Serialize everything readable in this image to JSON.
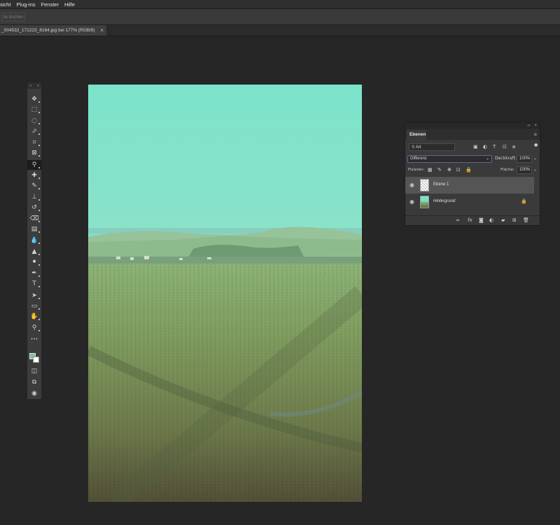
{
  "menu": [
    "sicht",
    "Plug-ins",
    "Fenster",
    "Hilfe"
  ],
  "options": {
    "button_label": "lle löschen"
  },
  "document": {
    "tab_title": "_004532_171223_8164.jpg bei 177% (RGB/8)",
    "close": "×"
  },
  "toolbox": {
    "head_left": "‹‹",
    "head_right": "×",
    "tools": [
      {
        "name": "move-tool",
        "glyph": "✥"
      },
      {
        "name": "marquee-tool",
        "glyph": "⬚"
      },
      {
        "name": "lasso-tool",
        "glyph": "◌"
      },
      {
        "name": "quick-select-tool",
        "glyph": "⬀"
      },
      {
        "name": "crop-tool",
        "glyph": "⌗"
      },
      {
        "name": "frame-tool",
        "glyph": "⊠"
      },
      {
        "name": "eyedropper-tool",
        "glyph": "⚲"
      },
      {
        "name": "healing-brush-tool",
        "glyph": "✚"
      },
      {
        "name": "brush-tool",
        "glyph": "✎"
      },
      {
        "name": "clone-stamp-tool",
        "glyph": "⊥"
      },
      {
        "name": "history-brush-tool",
        "glyph": "↺"
      },
      {
        "name": "eraser-tool",
        "glyph": "⌫"
      },
      {
        "name": "gradient-tool",
        "glyph": "▤"
      },
      {
        "name": "blur-tool",
        "glyph": "💧"
      },
      {
        "name": "sharpen-tool",
        "glyph": "▲"
      },
      {
        "name": "dodge-tool",
        "glyph": "⚫"
      },
      {
        "name": "pen-tool",
        "glyph": "✒"
      },
      {
        "name": "type-tool",
        "glyph": "T"
      },
      {
        "name": "path-select-tool",
        "glyph": "➤"
      },
      {
        "name": "rectangle-tool",
        "glyph": "▭"
      },
      {
        "name": "hand-tool",
        "glyph": "✋"
      },
      {
        "name": "zoom-tool",
        "glyph": "⚲"
      },
      {
        "name": "more-tools",
        "glyph": "•••"
      }
    ]
  },
  "layers_panel": {
    "top_icons": [
      "‹‹",
      "×"
    ],
    "tab": "Ebenen",
    "filter_value": "Art",
    "blend_mode": "Differenz",
    "opacity_label": "Deckkraft:",
    "opacity_value": "100%",
    "lock_label": "Fixieren:",
    "fill_label": "Fläche:",
    "fill_value": "100%",
    "layers": [
      {
        "name": "Ebene 1",
        "selected": true
      },
      {
        "name": "Hintergrund",
        "selected": false
      }
    ],
    "bottom_icons": [
      "link-icon",
      "fx-icon",
      "mask-icon",
      "adjustment-icon",
      "folder-icon",
      "new-layer-icon",
      "trash-icon"
    ]
  },
  "colors": {
    "foreground": "#8bbe92",
    "background": "#ffffff",
    "sky": "#7fe0c8"
  }
}
